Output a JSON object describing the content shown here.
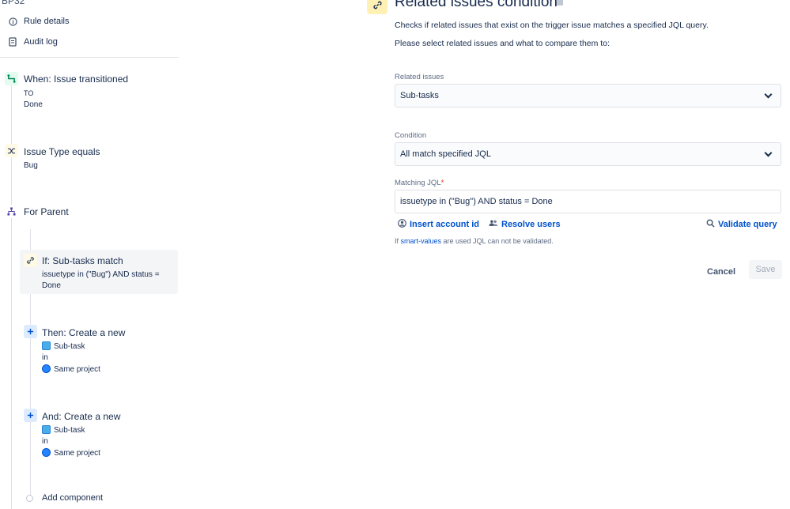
{
  "left": {
    "project_key": "BP32",
    "nav": [
      {
        "label": "Rule details",
        "icon": "info-icon"
      },
      {
        "label": "Audit log",
        "icon": "document-icon"
      }
    ],
    "trigger": {
      "title": "When: Issue transitioned",
      "line1": "TO",
      "line2": "Done",
      "icon": "trigger-icon"
    },
    "condition": {
      "title": "Issue Type equals",
      "line1": "Bug",
      "icon": "shuffle-icon"
    },
    "branch": {
      "title": "For Parent",
      "icon": "hierarchy-icon"
    },
    "if_block": {
      "title": "If: Sub-tasks match",
      "line1": "issuetype in (\"Bug\") AND status =",
      "line2": "Done",
      "icon": "link-icon"
    },
    "then_block": {
      "title": "Then: Create a new",
      "type": "Sub-task",
      "in": "in",
      "project": "Same project",
      "icon": "plus-icon"
    },
    "and_block": {
      "title": "And: Create a new",
      "type": "Sub-task",
      "in": "in",
      "project": "Same project",
      "icon": "plus-icon"
    },
    "add_component": "Add component"
  },
  "right": {
    "heading": "Related issues condition",
    "desc1": "Checks if related issues that exist on the trigger issue matches a specified JQL query.",
    "desc2": "Please select related issues and what to compare them to:",
    "related_issues": {
      "label": "Related issues",
      "value": "Sub-tasks"
    },
    "condition": {
      "label": "Condition",
      "value": "All match specified JQL"
    },
    "matching_jql": {
      "label": "Matching JQL",
      "required": "*",
      "value": "issuetype in (\"Bug\") AND status = Done"
    },
    "links": {
      "insert_account": "Insert account id",
      "resolve_users": "Resolve users",
      "validate_query": "Validate query"
    },
    "hint": {
      "prefix": "If ",
      "link": "smart-values",
      "suffix": " are used JQL can not be validated."
    },
    "buttons": {
      "cancel": "Cancel",
      "save": "Save"
    }
  }
}
